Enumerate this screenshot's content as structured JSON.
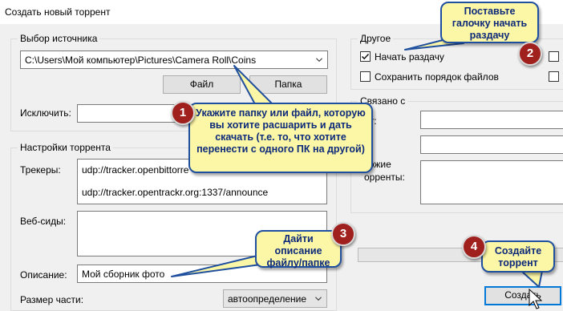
{
  "window": {
    "title": "Создать новый торрент"
  },
  "source": {
    "group_title": "Выбор источника",
    "path": "C:\\Users\\Мой компьютер\\Pictures\\Camera Roll\\Coins",
    "file_button": "Файл",
    "folder_button": "Папка",
    "exclude_label": "Исключить:"
  },
  "settings": {
    "group_title": "Настройки торрента",
    "trackers_label": "Трекеры:",
    "trackers": [
      "udp://tracker.openbittorre",
      "udp://tracker.opentrackr.org:1337/announce"
    ],
    "webseeds_label": "Веб-сиды:",
    "description_label": "Описание:",
    "description_value": "Мой сборник фото",
    "piece_size_label": "Размер части:",
    "piece_size_value": "автоопределение"
  },
  "other": {
    "group_title": "Другое",
    "start_seeding_label": "Начать раздачу",
    "start_seeding_checked": true,
    "preserve_order_label": "Сохранить порядок файлов",
    "preserve_order_checked": false
  },
  "related": {
    "group_title": "Связано с",
    "row1_label": "йт:",
    "row2_label": "S:",
    "row3_label_line1": "хожие",
    "row3_label_line2": "орренты:"
  },
  "create_button": "Создать",
  "annotations": {
    "callout1": "Укажите папку или файл, которую вы хотите расшарить и дать скачать (т.е. то, что хотите перенести с одного ПК на другой)",
    "callout2": "Поставьте галочку начать раздачу",
    "callout3": "Дайти описание файлу/папке",
    "callout4": "Создайте торрент",
    "badge1": "1",
    "badge2": "2",
    "badge3": "3",
    "badge4": "4"
  },
  "colors": {
    "callout_fill": "#fcf7a6",
    "callout_border": "#1f4f9f",
    "badge_fill": "#a0201e"
  }
}
